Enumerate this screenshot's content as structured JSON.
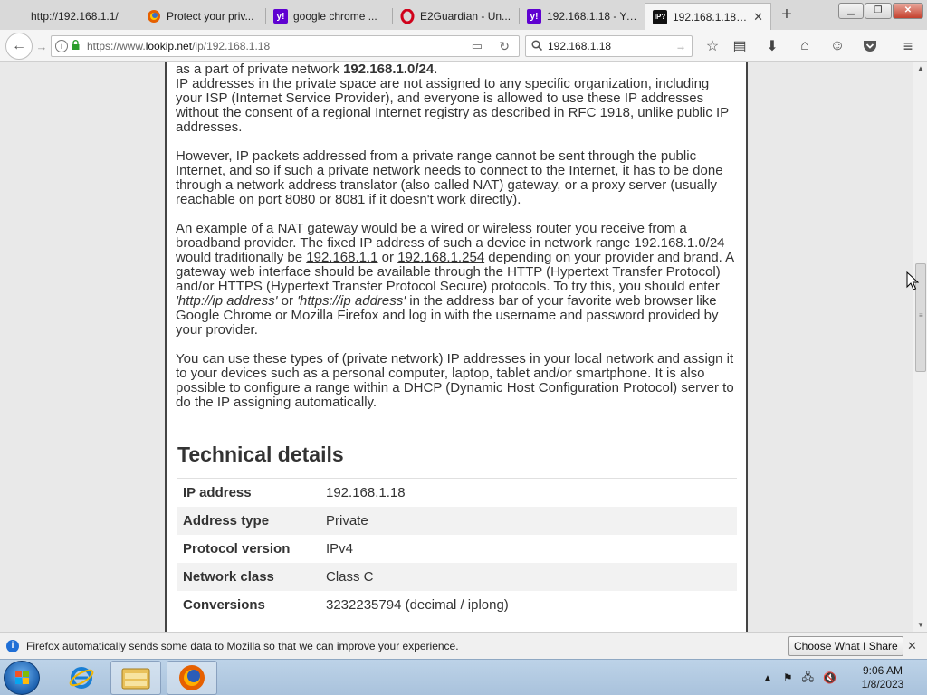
{
  "browser": {
    "tabs": [
      {
        "title": "http://192.168.1.1/",
        "favicon": "blank-page-icon"
      },
      {
        "title": "Protect your priv...",
        "favicon": "firefox-icon"
      },
      {
        "title": "google chrome ...",
        "favicon": "yahoo-icon"
      },
      {
        "title": "E2Guardian - Un...",
        "favicon": "opera-icon"
      },
      {
        "title": "192.168.1.18 - Ya...",
        "favicon": "yahoo-icon"
      },
      {
        "title": "192.168.1.18 -...",
        "favicon": "lookip-icon",
        "active": true
      }
    ],
    "url_prefix": "https://www.",
    "url_domain": "lookip.net",
    "url_path": "/ip/192.168.1.18",
    "search_value": "192.168.1.18",
    "lookip_favicon_text": "IP?"
  },
  "article": {
    "line1_prefix": "as a part of private network ",
    "line1_bold": "192.168.1.0/24",
    "line1_suffix": ".",
    "p1": "IP addresses in the private space are not assigned to any specific organization, including your ISP (Internet Service Provider), and everyone is allowed to use these IP addresses without the consent of a regional Internet registry as described in RFC 1918, unlike public IP addresses.",
    "p2": "However, IP packets addressed from a private range cannot be sent through the public Internet, and so if such a private network needs to connect to the Internet, it has to be done through a network address translator (also called NAT) gateway, or a proxy server (usually reachable on port 8080 or 8081 if it doesn't work directly).",
    "p3_a": "An example of a NAT gateway would be a wired or wireless router you receive from a broadband provider. The fixed IP address of such a device in network range 192.168.1.0/24 would traditionally be ",
    "p3_link1": "192.168.1.1",
    "p3_b": " or ",
    "p3_link2": "192.168.1.254",
    "p3_c": " depending on your provider and brand. A gateway web interface should be available through the HTTP (Hypertext Transfer Protocol) and/or HTTPS (Hypertext Transfer Protocol Secure) protocols. To try this, you should enter ",
    "p3_i1": "'http://ip address'",
    "p3_d": " or ",
    "p3_i2": "'https://ip address'",
    "p3_e": " in the address bar of your favorite web browser like Google Chrome or Mozilla Firefox and log in with the username and password provided by your provider.",
    "p4": "You can use these types of (private network) IP addresses in your local network and assign it to your devices such as a personal computer, laptop, tablet and/or smartphone. It is also possible to configure a range within a DHCP (Dynamic Host Configuration Protocol) server to do the IP assigning automatically.",
    "tech_heading": "Technical details",
    "tech_rows": [
      {
        "key": "IP address",
        "value": "192.168.1.18"
      },
      {
        "key": "Address type",
        "value": "Private"
      },
      {
        "key": "Protocol version",
        "value": "IPv4"
      },
      {
        "key": "Network class",
        "value": "Class C"
      },
      {
        "key": "Conversions",
        "value": "3232235794 (decimal / iplong)"
      }
    ]
  },
  "notification": {
    "message": "Firefox automatically sends some data to Mozilla so that we can improve your experience.",
    "button": "Choose What I Share"
  },
  "taskbar": {
    "time": "9:06 AM",
    "date": "1/8/2023",
    "apps": [
      "internet-explorer-icon",
      "file-explorer-icon",
      "firefox-icon"
    ]
  }
}
